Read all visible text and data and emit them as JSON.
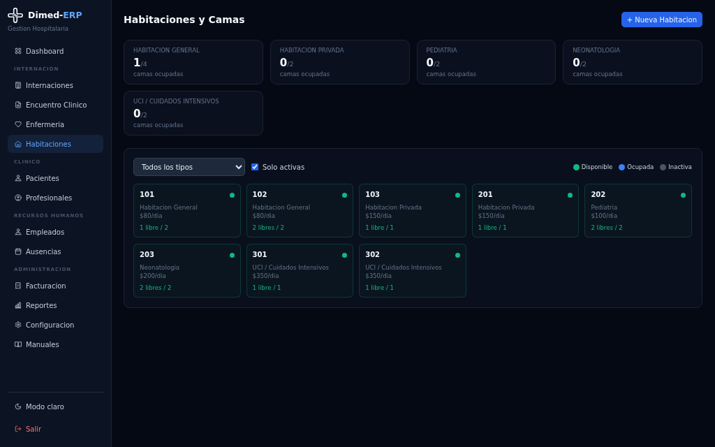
{
  "app": {
    "name": "Dimed-",
    "name_accent": "ERP",
    "subtitle": "Gestion Hospitalaria"
  },
  "sidebar": {
    "nav": [
      {
        "kind": "item",
        "label": "Dashboard",
        "selected": false
      },
      {
        "kind": "section",
        "label": "INTERNACION"
      },
      {
        "kind": "item",
        "label": "Internaciones",
        "selected": false
      },
      {
        "kind": "item",
        "label": "Encuentro Clinico",
        "selected": false
      },
      {
        "kind": "item",
        "label": "Enfermeria",
        "selected": false
      },
      {
        "kind": "item",
        "label": "Habitaciones",
        "selected": true
      },
      {
        "kind": "section",
        "label": "CLINICO"
      },
      {
        "kind": "item",
        "label": "Pacientes",
        "selected": false
      },
      {
        "kind": "item",
        "label": "Profesionales",
        "selected": false
      },
      {
        "kind": "section",
        "label": "RECURSOS HUMANOS"
      },
      {
        "kind": "item",
        "label": "Empleados",
        "selected": false
      },
      {
        "kind": "item",
        "label": "Ausencias",
        "selected": false
      },
      {
        "kind": "section",
        "label": "ADMINISTRACION"
      },
      {
        "kind": "item",
        "label": "Facturacion",
        "selected": false
      },
      {
        "kind": "item",
        "label": "Reportes",
        "selected": false
      },
      {
        "kind": "item",
        "label": "Configuracion",
        "selected": false
      },
      {
        "kind": "item",
        "label": "Manuales",
        "selected": false
      }
    ],
    "footer": [
      {
        "kind": "theme",
        "label": "Modo claro"
      },
      {
        "kind": "logout",
        "label": "Salir"
      }
    ]
  },
  "page": {
    "title": "Habitaciones y Camas",
    "new_button": "+ Nueva Habitacion"
  },
  "stats": [
    {
      "label": "HABITACION GENERAL",
      "occupied": "1",
      "total": "/4",
      "caption": "camas ocupadas"
    },
    {
      "label": "HABITACION PRIVADA",
      "occupied": "0",
      "total": "/2",
      "caption": "camas ocupadas"
    },
    {
      "label": "PEDIATRIA",
      "occupied": "0",
      "total": "/2",
      "caption": "camas ocupadas"
    },
    {
      "label": "NEONATOLOGIA",
      "occupied": "0",
      "total": "/2",
      "caption": "camas ocupadas"
    },
    {
      "label": "UCI / CUIDADOS INTENSIVOS",
      "occupied": "0",
      "total": "/2",
      "caption": "camas ocupadas"
    }
  ],
  "filters": {
    "type_select": {
      "value": "Todos los tipos"
    },
    "only_active": {
      "label": "Solo activas",
      "checked": true
    }
  },
  "legend": [
    {
      "label": "Disponible",
      "color": "#10b981"
    },
    {
      "label": "Ocupada",
      "color": "#3b82f6"
    },
    {
      "label": "Inactiva",
      "color": "#4b5563"
    }
  ],
  "rooms": [
    {
      "number": "101",
      "type": "Habitacion General",
      "price": "$80/dia",
      "beds": "1 libre / 2",
      "color": "#10b981"
    },
    {
      "number": "102",
      "type": "Habitacion General",
      "price": "$80/dia",
      "beds": "2 libres / 2",
      "color": "#10b981"
    },
    {
      "number": "103",
      "type": "Habitacion Privada",
      "price": "$150/dia",
      "beds": "1 libre / 1",
      "color": "#10b981"
    },
    {
      "number": "201",
      "type": "Habitacion Privada",
      "price": "$150/dia",
      "beds": "1 libre / 1",
      "color": "#10b981"
    },
    {
      "number": "202",
      "type": "Pediatria",
      "price": "$100/dia",
      "beds": "2 libres / 2",
      "color": "#10b981"
    },
    {
      "number": "203",
      "type": "Neonatologia",
      "price": "$200/dia",
      "beds": "2 libres / 2",
      "color": "#10b981"
    },
    {
      "number": "301",
      "type": "UCI / Cuidados Intensivos",
      "price": "$350/dia",
      "beds": "1 libre / 1",
      "color": "#10b981"
    },
    {
      "number": "302",
      "type": "UCI / Cuidados Intensivos",
      "price": "$350/dia",
      "beds": "1 libre / 1",
      "color": "#10b981"
    }
  ]
}
